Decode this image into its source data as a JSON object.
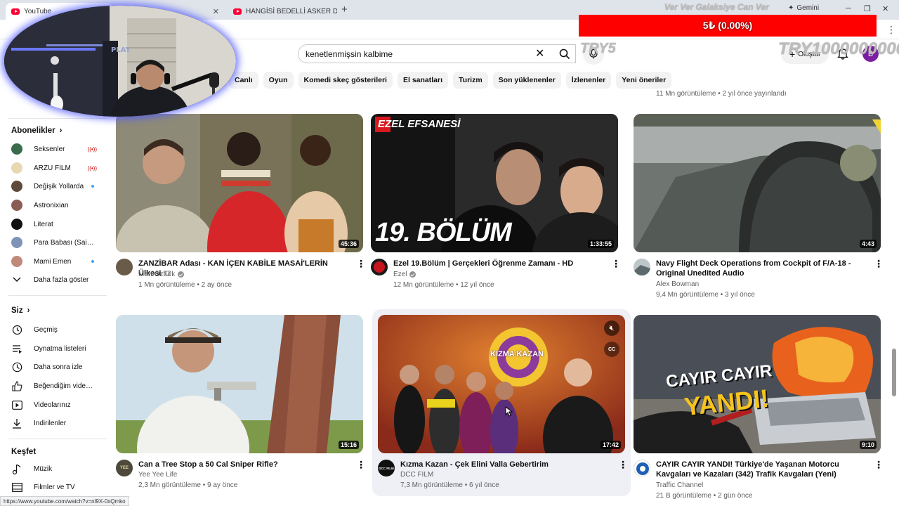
{
  "browser": {
    "tabs": [
      {
        "title": "YouTube"
      },
      {
        "title": ""
      },
      {
        "title": "HANGİSİ BEDELLİ ASKER DEĞİL"
      }
    ],
    "new_tab": "+",
    "gemini_label": "Gemini",
    "status_url": "https://www.youtube.com/watch?v=nl9X-0xQmko"
  },
  "stream_overlay": {
    "donation_text": "5₺ (0.00%)",
    "top_text": "Ver Ver Galaksiye Can Ver",
    "try_small": "TRY5",
    "try_large": "TRY1000000000",
    "banner_color": "#ff0000"
  },
  "header": {
    "search_value": "kenetlenmişsin kalbime",
    "create_label": "Oluştur",
    "avatar_letter": "B"
  },
  "chips": [
    "Canlı",
    "Oyun",
    "Komedi skeç gösterileri",
    "El sanatları",
    "Turizm",
    "Son yüklenenler",
    "İzlenenler",
    "Yeni öneriler"
  ],
  "previous_row_meta": "11 Mn görüntüleme • 2 yıl önce yayınlandı",
  "sidebar": {
    "subscriptions_heading": "Abonelikler",
    "subscriptions": [
      {
        "label": "Seksenler",
        "status": "live"
      },
      {
        "label": "ARZU FİLM",
        "status": "live"
      },
      {
        "label": "Değişik Yollarda",
        "status": "new"
      },
      {
        "label": "Astronixian",
        "status": ""
      },
      {
        "label": "Literat",
        "status": ""
      },
      {
        "label": "Para Babası (Said Y...",
        "status": ""
      },
      {
        "label": "Mami Emen",
        "status": "new"
      }
    ],
    "show_more": "Daha fazla göster",
    "you_heading": "Siz",
    "you_items": [
      {
        "label": "Geçmiş",
        "icon": "history-icon"
      },
      {
        "label": "Oynatma listeleri",
        "icon": "playlists-icon"
      },
      {
        "label": "Daha sonra izle",
        "icon": "watch-later-icon"
      },
      {
        "label": "Beğendiğim videolar",
        "icon": "like-icon"
      },
      {
        "label": "Videolarınız",
        "icon": "your-videos-icon"
      },
      {
        "label": "İndirilenler",
        "icon": "download-icon"
      }
    ],
    "explore_heading": "Keşfet",
    "explore_items": [
      {
        "label": "Müzik",
        "icon": "music-icon"
      },
      {
        "label": "Filmler ve TV",
        "icon": "film-icon"
      }
    ]
  },
  "videos": [
    {
      "title": "ZANZİBAR Adası - KAN İÇEN KABİLE MASAİ'LERİN Ülkesi",
      "title_suffix": "TZ",
      "channel": "Mert Öztürk",
      "verified": true,
      "meta": "1 Mn görüntüleme • 2 ay önce",
      "duration": "45:36"
    },
    {
      "title": "Ezel 19.Bölüm | Gerçekleri Öğrenme Zamanı - HD",
      "title_suffix": "",
      "channel": "Ezel",
      "verified": true,
      "meta": "12 Mn görüntüleme • 12 yıl önce",
      "duration": "1:33:55",
      "thumb_badge": "EZEL EFSANESİ",
      "thumb_text": "19. BÖLÜM"
    },
    {
      "title": "Navy Flight Deck Operations from Cockpit of F/A-18 - Original Unedited Audio",
      "title_suffix": "",
      "channel": "Alex Bowman",
      "verified": false,
      "meta": "9,4 Mn görüntüleme • 3 yıl önce",
      "duration": "4:43"
    },
    {
      "title": "Can a Tree Stop a 50 Cal Sniper Rifle?",
      "title_suffix": "",
      "channel": "Yee Yee Life",
      "verified": false,
      "meta": "2,3 Mn görüntüleme • 9 ay önce",
      "duration": "15:16",
      "avatar_text": "YEE"
    },
    {
      "title": "Kızma Kazan - Çek Elini Valla Gebertirim",
      "title_suffix": "",
      "channel": "DCC FILM",
      "verified": false,
      "meta": "7,3 Mn görüntüleme • 6 yıl önce",
      "duration": "17:42",
      "thumb_text": "KIZMA KAZAN",
      "avatar_text": "DCC FILM"
    },
    {
      "title": "CAYIR CAYIR YANDI! Türkiye'de Yaşanan Motorcu Kavgaları ve Kazaları (342) Trafik Kavgaları (Yeni)",
      "title_suffix": "",
      "channel": "Traffic Channel",
      "verified": false,
      "meta": "21 B görüntüleme • 2 gün önce",
      "duration": "9:10",
      "thumb_text_1": "CAYIR CAYIR",
      "thumb_text_2": "YANDI!"
    }
  ]
}
